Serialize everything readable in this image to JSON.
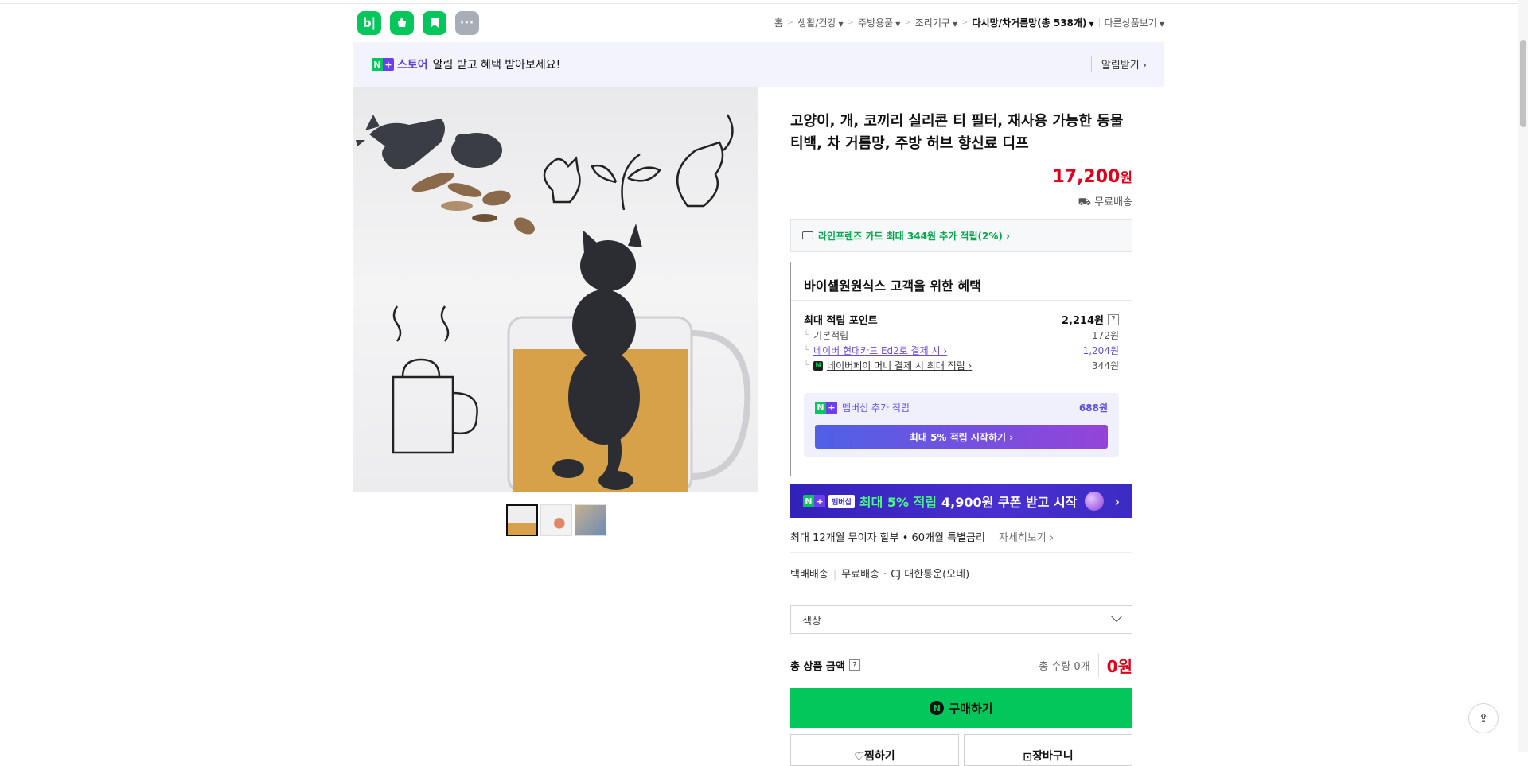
{
  "header": {
    "app_icons": [
      {
        "label": "b|",
        "icon": "blog-icon"
      },
      {
        "label": "",
        "icon": "shopping-icon"
      },
      {
        "label": "",
        "icon": "bookmark-icon"
      },
      {
        "label": "···",
        "icon": "more-icon"
      }
    ],
    "breadcrumb": {
      "home": "홈",
      "items": [
        "생활/건강",
        "주방용품",
        "조리기구"
      ],
      "current": "다시망/차거름망(총 538개)",
      "other": "다른상품보기"
    }
  },
  "store_banner": {
    "badge_n": "N",
    "badge_plus": "+",
    "store_name": "스토어",
    "message": "알림 받고 혜택 받아보세요!",
    "notify_label": "알림받기 ›"
  },
  "product": {
    "title": "고양이, 개, 코끼리 실리콘 티 필터, 재사용 가능한 동물 티백, 차 거름망, 주방 허브 향신료 디프",
    "price": "17,200",
    "price_unit": "원",
    "shipping": "무료배송",
    "card_promo": "라인프렌즈 카드 최대 344원 추가 적립(2%) ›",
    "thumbnails": 3
  },
  "benefit": {
    "heading": "바이셀원원식스 고객을 위한 혜택",
    "max_points_label": "최대 적립 포인트",
    "max_points_value": "2,214원",
    "rows": [
      {
        "label": "기본적립",
        "value": "172원",
        "type": "plain"
      },
      {
        "label": "네이버 현대카드 Ed2로 결제 시 ›",
        "value": "1,204원",
        "type": "card"
      },
      {
        "label": "네이버페이 머니 결제 시 최대 적립 ›",
        "value": "344원",
        "type": "npay"
      }
    ],
    "membership_label": "멤버십 추가 적립",
    "membership_value": "688원",
    "membership_button": "최대 5% 적립 시작하기 ›"
  },
  "membership_banner": {
    "badge": "멤버십",
    "highlight": "최대 5% 적립",
    "text": "4,900원 쿠폰 받고 시작",
    "arrow": "›"
  },
  "installment": {
    "text": "최대 12개월 무이자 할부 • 60개월 특별금리",
    "detail": "자세히보기 ›"
  },
  "delivery": {
    "method": "택배배송",
    "fee": "무료배송",
    "carrier": "CJ 대한통운(오네)"
  },
  "option_select": {
    "placeholder": "색상"
  },
  "total": {
    "label": "총 상품 금액",
    "quantity": "총 수량 0개",
    "amount": "0원"
  },
  "actions": {
    "buy": "구매하기",
    "wish": "찜하기",
    "cart": "장바구니"
  },
  "colors": {
    "naver_green": "#03c75a",
    "price_red": "#e0001b",
    "plus_purple": "#6d3ef0"
  }
}
